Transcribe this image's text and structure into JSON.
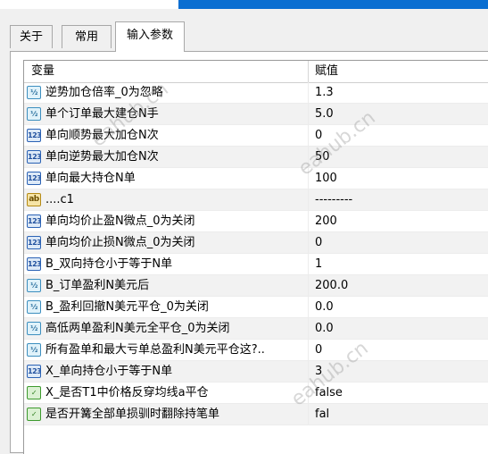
{
  "tabs": [
    {
      "label": "关于"
    },
    {
      "label": "常用"
    },
    {
      "label": "输入参数"
    }
  ],
  "table": {
    "headers": {
      "name": "变量",
      "value": "赋值"
    },
    "rows": [
      {
        "icon": "double",
        "icon_text": "½",
        "name": "逆势加仓倍率_0为忽略",
        "value": "1.3"
      },
      {
        "icon": "double",
        "icon_text": "½",
        "name": "单个订单最大建仓N手",
        "value": "5.0"
      },
      {
        "icon": "int",
        "icon_text": "123",
        "name": "单向顺势最大加仓N次",
        "value": "0"
      },
      {
        "icon": "int",
        "icon_text": "123",
        "name": "单向逆势最大加仓N次",
        "value": "50"
      },
      {
        "icon": "int",
        "icon_text": "123",
        "name": "单向最大持仓N单",
        "value": "100"
      },
      {
        "icon": "string",
        "icon_text": "ab",
        "name": "....c1",
        "value": "---------"
      },
      {
        "icon": "int",
        "icon_text": "123",
        "name": "单向均价止盈N微点_0为关闭",
        "value": "200"
      },
      {
        "icon": "int",
        "icon_text": "123",
        "name": "单向均价止损N微点_0为关闭",
        "value": "0"
      },
      {
        "icon": "int",
        "icon_text": "123",
        "name": "B_双向持仓小于等于N单",
        "value": "1"
      },
      {
        "icon": "double",
        "icon_text": "½",
        "name": "B_订单盈利N美元后",
        "value": "200.0"
      },
      {
        "icon": "double",
        "icon_text": "½",
        "name": "B_盈利回撤N美元平仓_0为关闭",
        "value": "0.0"
      },
      {
        "icon": "double",
        "icon_text": "½",
        "name": "高低两单盈利N美元全平仓_0为关闭",
        "value": "0.0"
      },
      {
        "icon": "double",
        "icon_text": "½",
        "name": "所有盈单和最大亏单总盈利N美元平仓这?..",
        "value": "0"
      },
      {
        "icon": "int",
        "icon_text": "123",
        "name": "X_单向持仓小于等于N单",
        "value": "3"
      },
      {
        "icon": "bool",
        "icon_text": "✓",
        "name": "X_是否T1中价格反穿均线a平仓",
        "value": "false"
      },
      {
        "icon": "bool",
        "icon_text": "✓",
        "name": "是否开篝全部单损驯时翻除持笔单",
        "value": "fal"
      }
    ]
  },
  "watermark": "eahub.cn",
  "colors": {
    "title_bar": "#0a6ed1",
    "row_alt": "#f2f2f2"
  }
}
